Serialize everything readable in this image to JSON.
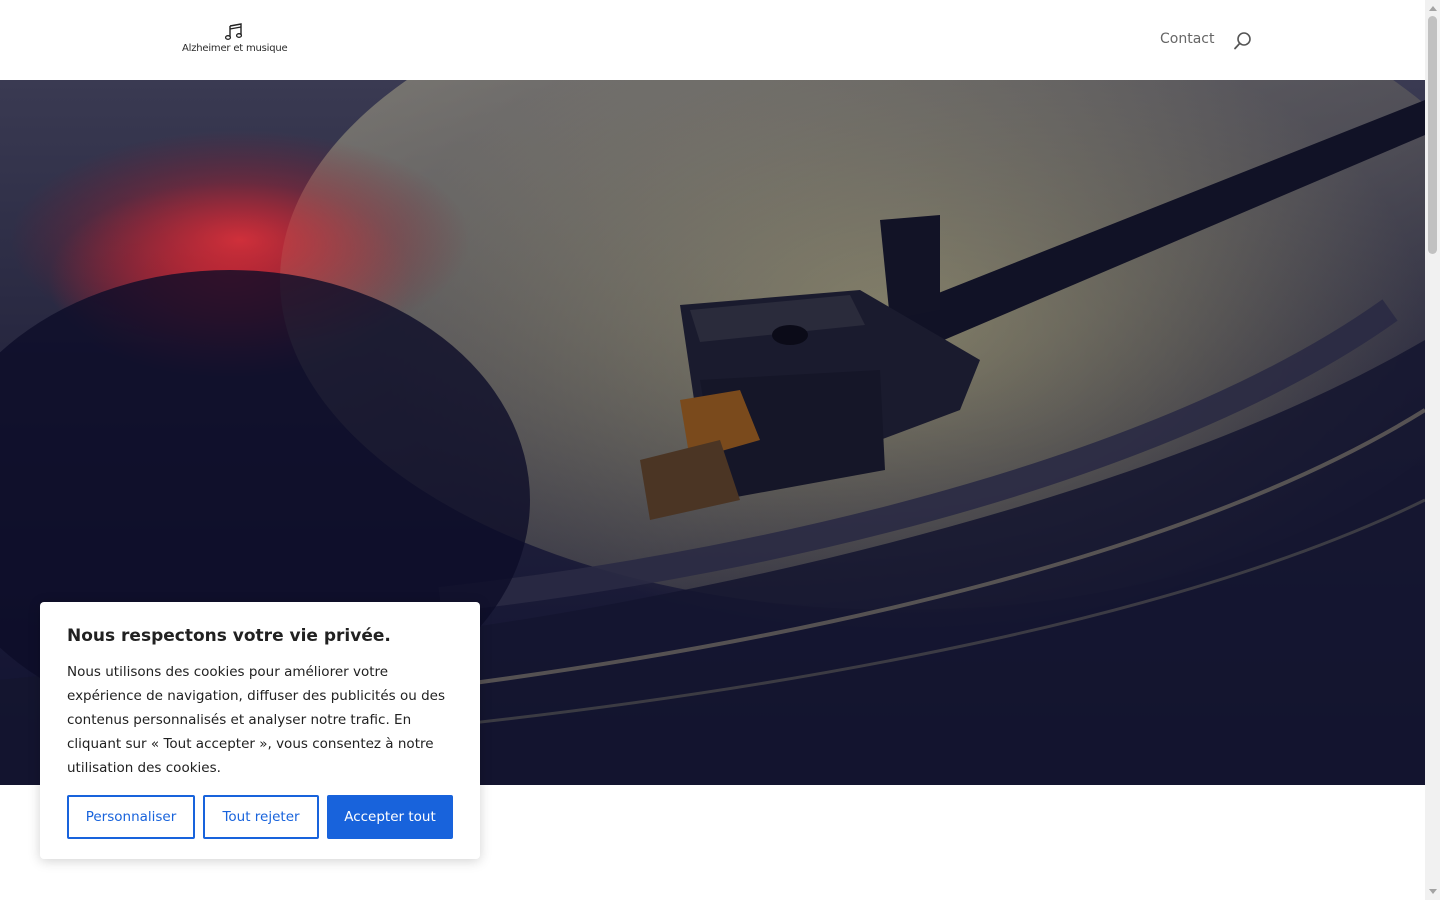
{
  "header": {
    "logo_text": "Alzheimer et musique",
    "nav": {
      "contact_label": "Contact"
    }
  },
  "hero": {
    "image": "vinyl-turntable-stylus"
  },
  "cookie_banner": {
    "title": "Nous respectons votre vie privée.",
    "text": "Nous utilisons des cookies pour améliorer votre expérience de navigation, diffuser des publicités ou des contenus personnalisés et analyser notre trafic. En cliquant sur « Tout accepter », vous consentez à notre utilisation des cookies.",
    "customize_label": "Personnaliser",
    "reject_label": "Tout rejeter",
    "accept_label": "Accepter tout"
  },
  "colors": {
    "accent": "#1863dc",
    "nav_text": "#666666",
    "hero_overlay": "#0f1030"
  },
  "icons": {
    "logo": "music-note-icon",
    "search": "search-icon"
  }
}
